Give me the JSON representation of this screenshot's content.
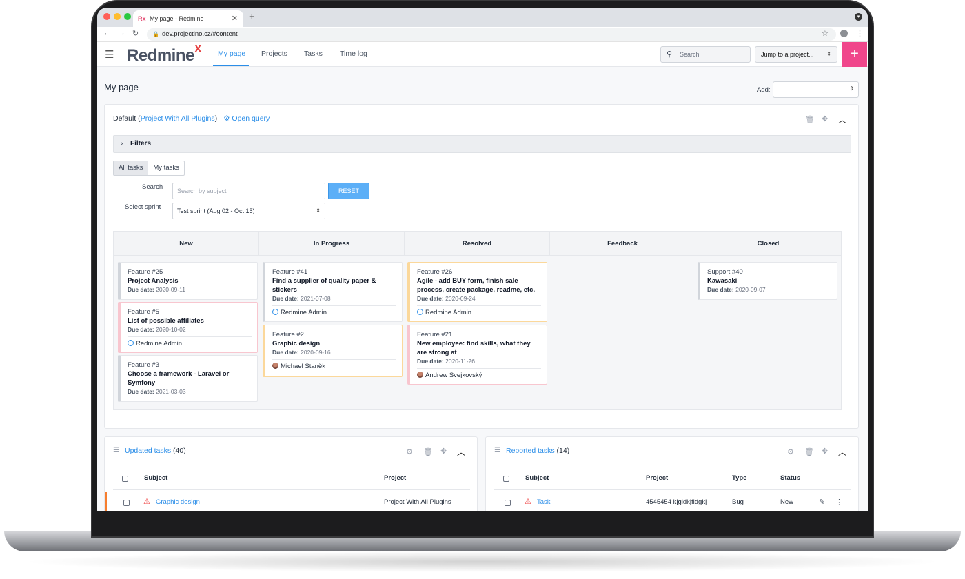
{
  "browser": {
    "tab_title": "My page - Redmine",
    "tab_favicon": "Rx",
    "url": "dev.projectino.cz/#content"
  },
  "header": {
    "logo_text": "Redmine",
    "logo_mark": "X",
    "nav": [
      "My page",
      "Projects",
      "Tasks",
      "Time log"
    ],
    "active_nav": "My page",
    "search_placeholder": "Search",
    "jump_label": "Jump to a project..."
  },
  "page": {
    "title": "My page",
    "add_label": "Add:"
  },
  "main_panel": {
    "title_prefix": "Default (",
    "project_link": "Project With All Plugins",
    "title_suffix": ")",
    "open_query": "Open query",
    "filters_label": "Filters",
    "toggle": [
      "All tasks",
      "My tasks"
    ],
    "search_label": "Search",
    "search_placeholder": "Search by subject",
    "reset_label": "RESET",
    "sprint_label": "Select sprint",
    "sprint_value": "Test sprint (Aug 02 - Oct 15)"
  },
  "board": {
    "columns": [
      "New",
      "In Progress",
      "Resolved",
      "Feedback",
      "Closed"
    ],
    "due_label": "Due date:",
    "cards": {
      "c1": {
        "ref": "Feature #25",
        "subject": "Project Analysis",
        "due": "2020-09-11"
      },
      "c2": {
        "ref": "Feature #5",
        "subject": "List of possible affiliates",
        "due": "2020-10-02",
        "assignee": "Redmine Admin"
      },
      "c3": {
        "ref": "Feature #3",
        "subject": "Choose a framework - Laravel or Symfony",
        "due": "2021-03-03"
      },
      "c4": {
        "ref": "Feature #41",
        "subject": "Find a supplier of quality paper & stickers",
        "due": "2021-07-08",
        "assignee": "Redmine Admin"
      },
      "c5": {
        "ref": "Feature #2",
        "subject": "Graphic design",
        "due": "2020-09-16",
        "assignee": "Michael Staněk"
      },
      "c6": {
        "ref": "Feature #26",
        "subject": "Agile - add BUY form, finish sale process, create package, readme, etc.",
        "due": "2020-09-24",
        "assignee": "Redmine Admin"
      },
      "c7": {
        "ref": "Feature #21",
        "subject": "New employee: find skills, what they are strong at",
        "due": "2020-11-26",
        "assignee": "Andrew Svejkovský"
      },
      "c8": {
        "ref": "Support #40",
        "subject": "Kawasaki",
        "due": "2020-09-07"
      }
    }
  },
  "updated_tasks": {
    "title": "Updated tasks",
    "count": "(40)",
    "headers": [
      "Subject",
      "Project"
    ],
    "row": {
      "subject": "Graphic design",
      "project": "Project With All Plugins"
    }
  },
  "reported_tasks": {
    "title": "Reported tasks",
    "count": "(14)",
    "headers": [
      "Subject",
      "Project",
      "Type",
      "Status"
    ],
    "row": {
      "subject": "Task",
      "project": "4545454 kjgldkjfldgkj",
      "type": "Bug",
      "status": "New"
    }
  },
  "colors": {
    "accent": "#2b8ee8",
    "plus_button": "#f0468b",
    "card_red": "#ef4461",
    "card_orange": "#f77e2e"
  },
  "icons": [
    "hamburger-icon",
    "search-icon",
    "plus-icon",
    "gear-icon",
    "trash-icon",
    "move-icon",
    "collapse-icon",
    "chevron-right-icon",
    "warning-icon",
    "edit-icon",
    "more-icon",
    "list-icon"
  ]
}
